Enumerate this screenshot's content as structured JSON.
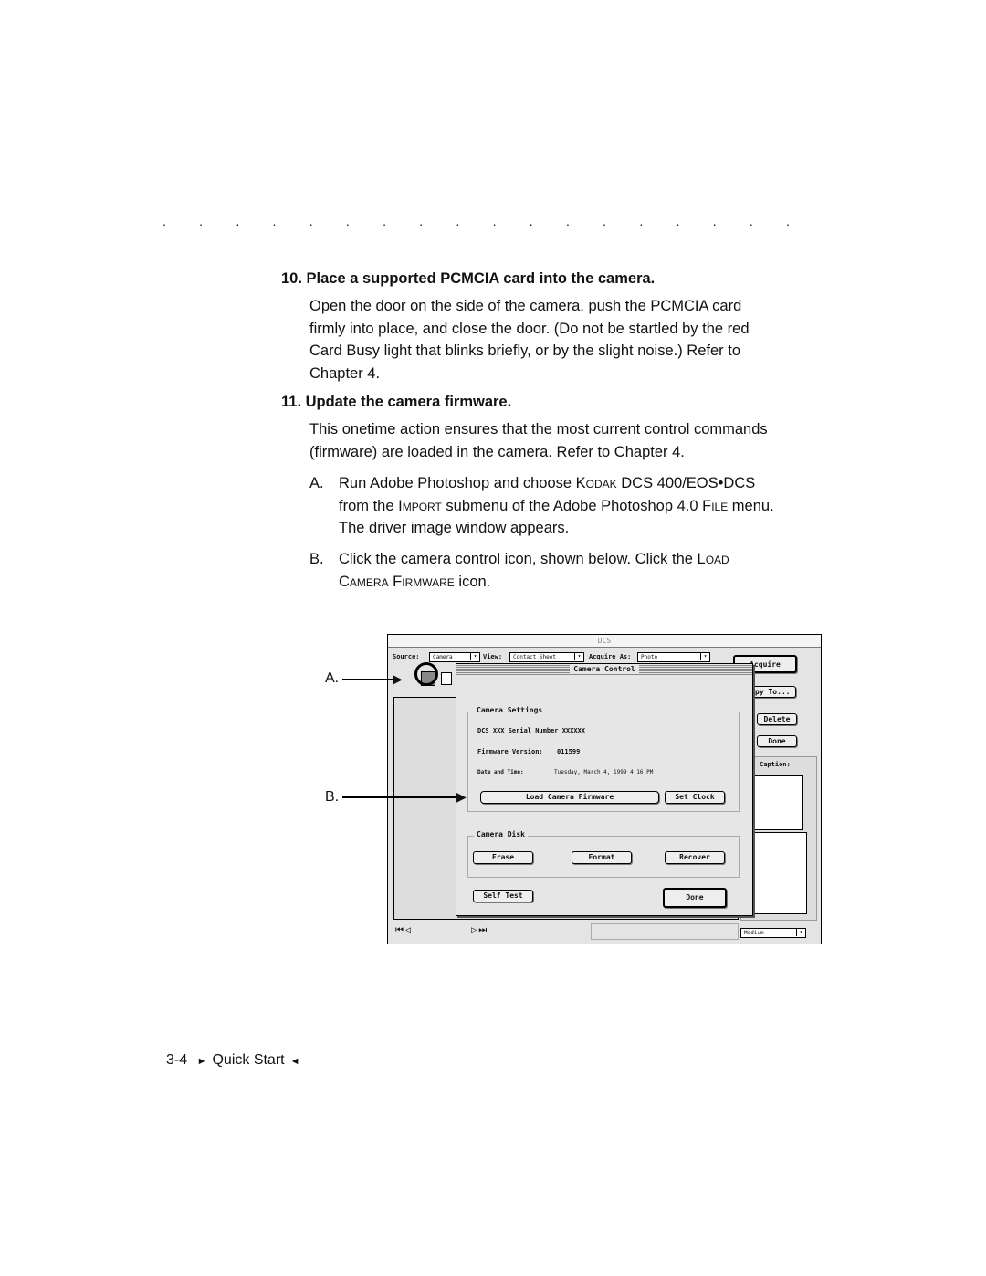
{
  "divider": ". . . . . . . . . . . . . . . . . . . . . . . . . . . . . .",
  "step10": {
    "heading": "10. Place a supported PCMCIA card into the camera.",
    "lines": [
      "Open the door on the side of the camera, push the PCMCIA card",
      "firmly into place, and close the door. (Do not be startled by the red",
      "Card Busy light that blinks briefly, or by the slight noise.) Refer to",
      "Chapter 4."
    ]
  },
  "step11": {
    "heading": "11. Update the camera firmware.",
    "lines": [
      "This onetime action ensures that the most current control commands",
      "(firmware) are loaded in the camera. Refer to Chapter 4."
    ],
    "a": {
      "marker": "A.",
      "t1": "Run Adobe Photoshop and choose ",
      "sc1": "Kodak",
      "t2": " DCS 400/EOS•DCS",
      "t3": "from the ",
      "sc2": "Import",
      "t4": " submenu of the Adobe Photoshop 4.0 ",
      "sc3": "File",
      "t5": " menu.",
      "t6": "The driver image window appears."
    },
    "b": {
      "marker": "B.",
      "t1": "Click the camera control icon, shown below. Click the ",
      "sc1": "Load",
      "sc2": "Camera Firmware",
      "t2": " icon."
    }
  },
  "screenshot": {
    "window_title": "DCS",
    "source_label": "Source:",
    "source_value": "Camera",
    "view_label": "View:",
    "view_value": "Contact Sheet",
    "acquire_as_label": "Acquire As:",
    "acquire_as_value": "Photo",
    "buttons": {
      "acquire": "Acquire",
      "copy_to": "Copy To...",
      "delete": "Delete",
      "done": "Done"
    },
    "info_label": "Caption:",
    "size_value": "Medium",
    "dialog": {
      "title": "Camera Control",
      "settings_group": "Camera Settings",
      "serial": "DCS XXX Serial Number XXXXXX",
      "fw_label": "Firmware Version:",
      "fw_value": "011599",
      "dt_label": "Date and Time:",
      "dt_value": "Tuesday, March 4, 1999  4:16 PM",
      "load_fw": "Load Camera Firmware",
      "set_clock": "Set Clock",
      "disk_group": "Camera Disk",
      "erase": "Erase",
      "format": "Format",
      "recover": "Recover",
      "self_test": "Self Test",
      "done": "Done"
    }
  },
  "callouts": {
    "a": "A.",
    "b": "B."
  },
  "footer": {
    "page": "3-4",
    "title": "Quick Start"
  }
}
